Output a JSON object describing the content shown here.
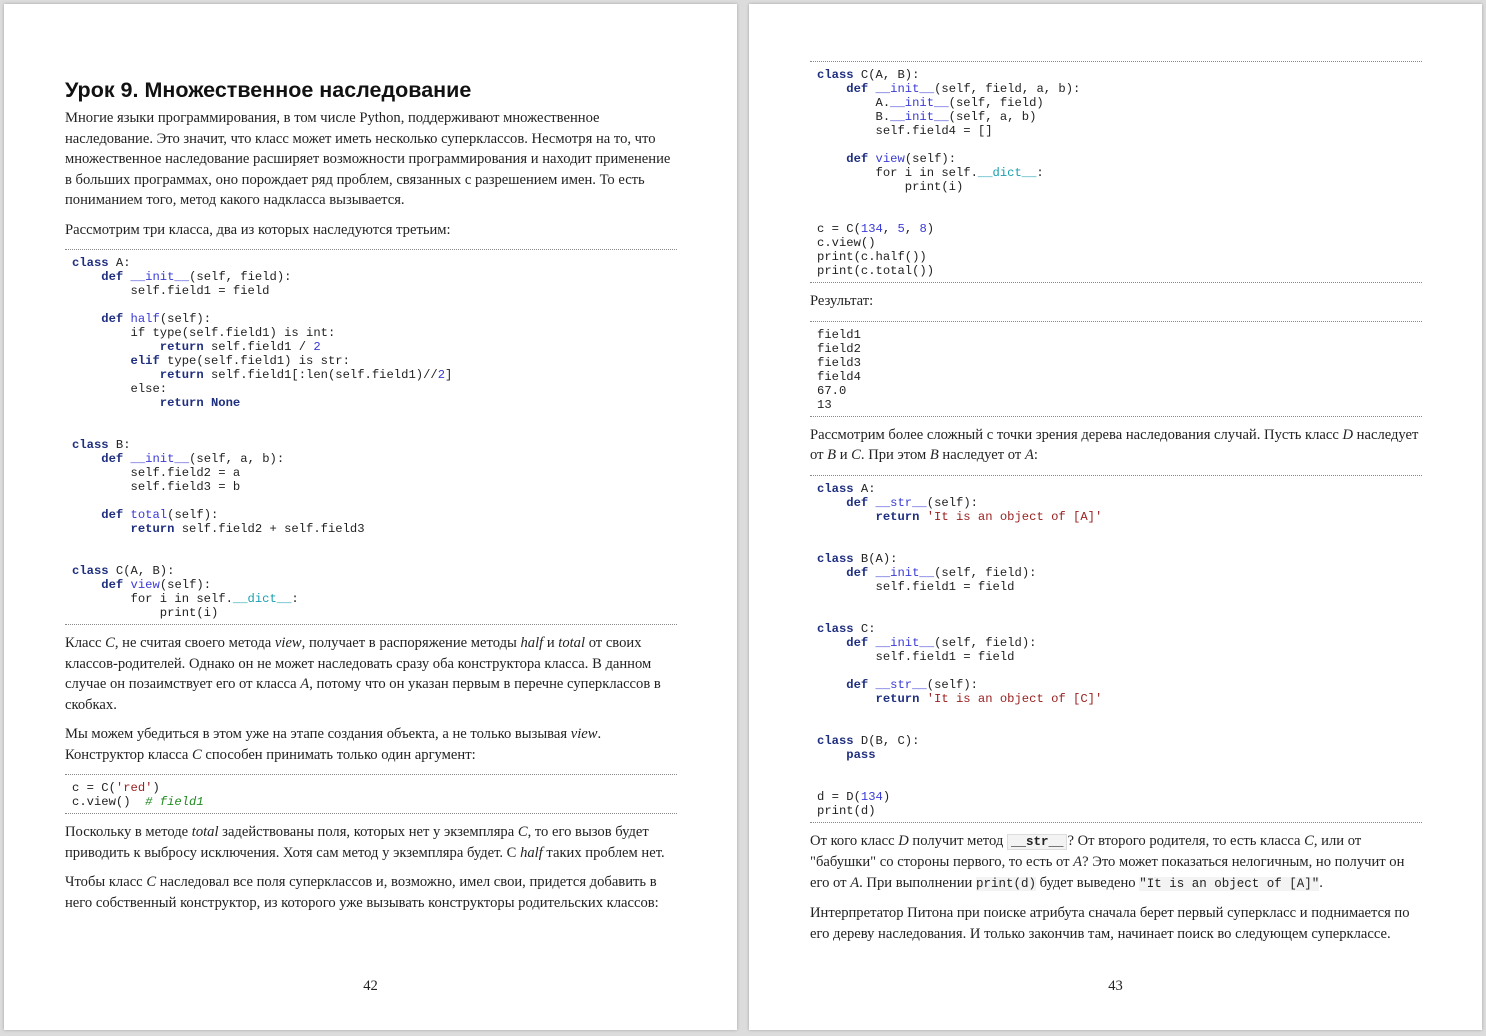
{
  "page_left": {
    "title": "Урок 9. Множественное наследование",
    "page_number": "42",
    "blocks": [
      {
        "type": "p",
        "segs": [
          [
            "Многие языки программирования, в том числе Python, поддерживают множественное наследование. Это значит, что класс может иметь несколько суперклассов. Несмотря на то, что множественное наследование расширяет возможности программирования и находит применение в больших программах, оно порождает ряд проблем, связанных с разрешением имен. То есть пониманием того, метод какого надкласса вызывается.",
            ""
          ]
        ]
      },
      {
        "type": "p",
        "segs": [
          [
            "Рассмотрим три класса, два из которых наследуются третьим:",
            ""
          ]
        ]
      },
      {
        "type": "code",
        "lines": [
          "class A:",
          "    def __init__(self, field):",
          "        self.field1 = field",
          "",
          "    def half(self):",
          "        if type(self.field1) is int:",
          "            return self.field1 / 2",
          "        elif type(self.field1) is str:",
          "            return self.field1[:len(self.field1)//2]",
          "        else:",
          "            return None",
          "",
          "",
          "class B:",
          "    def __init__(self, a, b):",
          "        self.field2 = a",
          "        self.field3 = b",
          "",
          "    def total(self):",
          "        return self.field2 + self.field3",
          "",
          "",
          "class C(A, B):",
          "    def view(self):",
          "        for i in self.__dict__:",
          "            print(i)"
        ]
      },
      {
        "type": "p",
        "segs": [
          [
            "Класс ",
            ""
          ],
          [
            "C",
            "i"
          ],
          [
            ", не считая своего метода ",
            ""
          ],
          [
            "view",
            "i"
          ],
          [
            ", получает в распоряжение методы ",
            ""
          ],
          [
            "half",
            "i"
          ],
          [
            " и ",
            ""
          ],
          [
            "total",
            "i"
          ],
          [
            " от своих классов-родителей. Однако он не может наследовать сразу оба конструктора класса. В данном случае он позаимствует его от класса ",
            ""
          ],
          [
            "A",
            "i"
          ],
          [
            ", потому что он указан первым в перечне суперклассов в скобках.",
            ""
          ]
        ]
      },
      {
        "type": "p",
        "segs": [
          [
            "Мы можем убедиться в этом уже на этапе создания объекта, а не только вызывая ",
            ""
          ],
          [
            "view",
            "i"
          ],
          [
            ". Конструктор класса ",
            ""
          ],
          [
            "C",
            "i"
          ],
          [
            " способен принимать только один аргумент:",
            ""
          ]
        ]
      },
      {
        "type": "code",
        "lines": [
          "c = C('red')",
          "c.view()  # field1"
        ]
      },
      {
        "type": "p",
        "segs": [
          [
            "Поскольку в методе ",
            ""
          ],
          [
            "total",
            "i"
          ],
          [
            " задействованы поля, которых нет у экземпляра ",
            ""
          ],
          [
            "C",
            "i"
          ],
          [
            ", то его вызов будет приводить к выбросу исключения. Хотя сам метод у экземпляра будет. С ",
            ""
          ],
          [
            "half",
            "i"
          ],
          [
            " таких проблем нет.",
            ""
          ]
        ]
      },
      {
        "type": "p",
        "segs": [
          [
            "Чтобы класс ",
            ""
          ],
          [
            "C",
            "i"
          ],
          [
            " наследовал все поля суперклассов и, возможно, имел свои, придется добавить в него собственный конструктор, из которого уже вызывать конструкторы родительских классов:",
            ""
          ]
        ]
      }
    ]
  },
  "page_right": {
    "page_number": "43",
    "blocks": [
      {
        "type": "code",
        "lines": [
          "class C(A, B):",
          "    def __init__(self, field, a, b):",
          "        A.__init__(self, field)",
          "        B.__init__(self, a, b)",
          "        self.field4 = []",
          "",
          "    def view(self):",
          "        for i in self.__dict__:",
          "            print(i)",
          "",
          "",
          "c = C(134, 5, 8)",
          "c.view()",
          "print(c.half())",
          "print(c.total())"
        ]
      },
      {
        "type": "p",
        "segs": [
          [
            "Результат:",
            ""
          ]
        ]
      },
      {
        "type": "code",
        "plain": true,
        "lines": [
          "field1",
          "field2",
          "field3",
          "field4",
          "67.0",
          "13"
        ]
      },
      {
        "type": "p",
        "segs": [
          [
            "Рассмотрим более сложный с точки зрения дерева наследования случай. Пусть класс ",
            ""
          ],
          [
            "D",
            "i"
          ],
          [
            " наследует от ",
            ""
          ],
          [
            "B",
            "i"
          ],
          [
            " и ",
            ""
          ],
          [
            "C",
            "i"
          ],
          [
            ". При этом ",
            ""
          ],
          [
            "B",
            "i"
          ],
          [
            " наследует от ",
            ""
          ],
          [
            "A",
            "i"
          ],
          [
            ":",
            ""
          ]
        ]
      },
      {
        "type": "code",
        "lines": [
          "class A:",
          "    def __str__(self):",
          "        return 'It is an object of [A]'",
          "",
          "",
          "class B(A):",
          "    def __init__(self, field):",
          "        self.field1 = field",
          "",
          "",
          "class C:",
          "    def __init__(self, field):",
          "        self.field1 = field",
          "",
          "    def __str__(self):",
          "        return 'It is an object of [C]'",
          "",
          "",
          "class D(B, C):",
          "    pass",
          "",
          "",
          "d = D(134)",
          "print(d)"
        ]
      },
      {
        "type": "p",
        "segs": [
          [
            "От кого класс ",
            ""
          ],
          [
            "D",
            "i"
          ],
          [
            " получит метод ",
            ""
          ],
          [
            "__str__",
            "cb"
          ],
          [
            "? От второго родителя, то есть класса ",
            ""
          ],
          [
            "C",
            "i"
          ],
          [
            ", или от \"бабушки\" со стороны первого, то есть от ",
            ""
          ],
          [
            "A",
            "i"
          ],
          [
            "? Это может показаться нелогичным, но получит он его от ",
            ""
          ],
          [
            "A",
            "i"
          ],
          [
            ". При выполнении ",
            ""
          ],
          [
            "print(d)",
            "c"
          ],
          [
            " будет выведено ",
            ""
          ],
          [
            "\"It is an object of [A]\"",
            "c"
          ],
          [
            ".",
            ""
          ]
        ]
      },
      {
        "type": "p",
        "segs": [
          [
            "Интерпретатор Питона при поиске атрибута сначала берет первый суперкласс и поднимается по его дереву наследования. И только закончив там, начинает поиск во следующем суперклассе.",
            ""
          ]
        ]
      }
    ]
  }
}
